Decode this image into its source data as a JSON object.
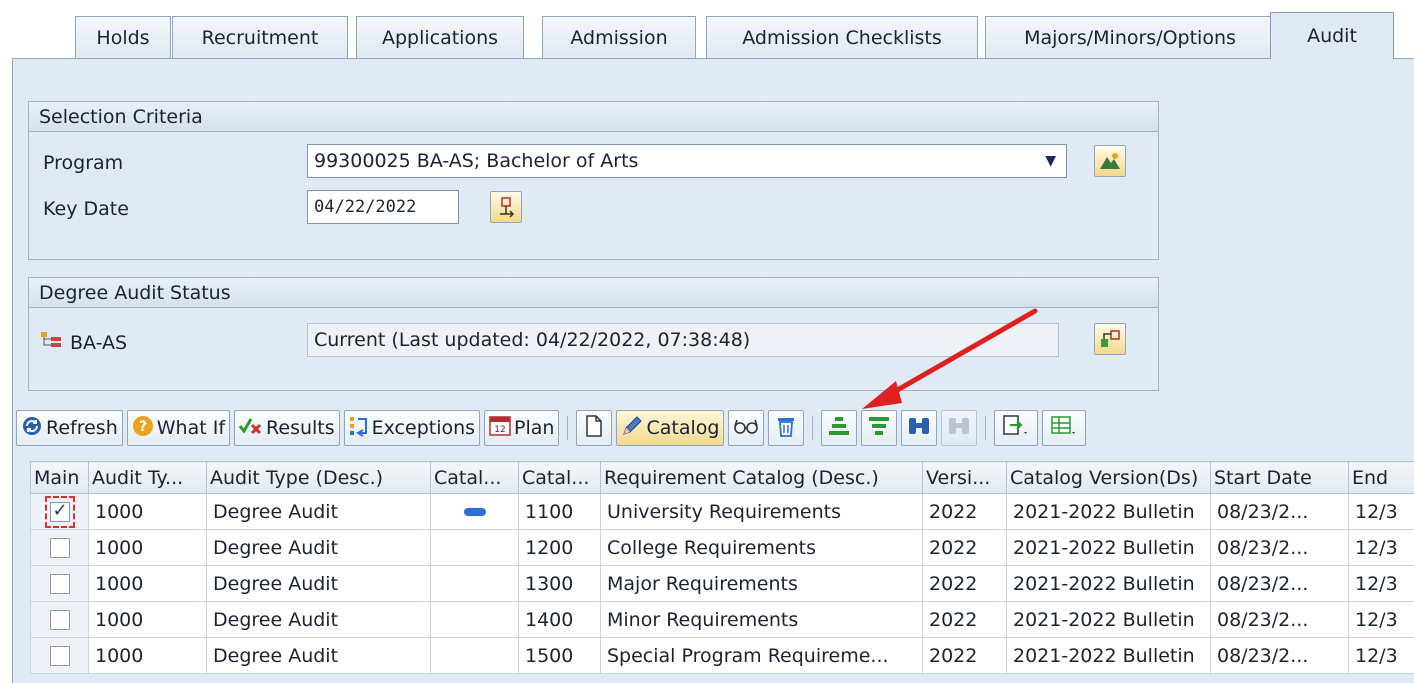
{
  "tabs": [
    {
      "label": "Holds"
    },
    {
      "label": "Recruitment"
    },
    {
      "label": "Applications"
    },
    {
      "label": "Admission"
    },
    {
      "label": "Admission Checklists"
    },
    {
      "label": "Majors/Minors/Options"
    },
    {
      "label": "Audit"
    }
  ],
  "selection": {
    "title": "Selection Criteria",
    "program_label": "Program",
    "program_value": "99300025 BA-AS; Bachelor of Arts",
    "key_date_label": "Key Date",
    "key_date_value": "04/22/2022"
  },
  "status": {
    "title": "Degree Audit Status",
    "program_code": "BA-AS",
    "status_text": "Current (Last updated: 04/22/2022, 07:38:48)"
  },
  "toolbar": {
    "refresh": "Refresh",
    "what_if": "What If",
    "results": "Results",
    "exceptions": "Exceptions",
    "plan": "Plan",
    "catalog": "Catalog"
  },
  "table": {
    "headers": [
      "Main",
      "Audit Ty...",
      "Audit Type (Desc.)",
      "Catal...",
      "Catal...",
      "Requirement Catalog (Desc.)",
      "Versi...",
      "Catalog Version(Ds)",
      "Start Date",
      "End"
    ],
    "rows": [
      {
        "main": true,
        "audit_type": "1000",
        "audit_desc": "Degree Audit",
        "cat1": "",
        "cat2": "1100",
        "req_desc": "University Requirements",
        "version": "2022",
        "cat_version": "2021-2022 Bulletin",
        "start": "08/23/2...",
        "end": "12/3"
      },
      {
        "main": false,
        "audit_type": "1000",
        "audit_desc": "Degree Audit",
        "cat1": "",
        "cat2": "1200",
        "req_desc": "College Requirements",
        "version": "2022",
        "cat_version": "2021-2022 Bulletin",
        "start": "08/23/2...",
        "end": "12/3"
      },
      {
        "main": false,
        "audit_type": "1000",
        "audit_desc": "Degree Audit",
        "cat1": "",
        "cat2": "1300",
        "req_desc": "Major Requirements",
        "version": "2022",
        "cat_version": "2021-2022 Bulletin",
        "start": "08/23/2...",
        "end": "12/3"
      },
      {
        "main": false,
        "audit_type": "1000",
        "audit_desc": "Degree Audit",
        "cat1": "",
        "cat2": "1400",
        "req_desc": "Minor Requirements",
        "version": "2022",
        "cat_version": "2021-2022 Bulletin",
        "start": "08/23/2...",
        "end": "12/3"
      },
      {
        "main": false,
        "audit_type": "1000",
        "audit_desc": "Degree Audit",
        "cat1": "",
        "cat2": "1500",
        "req_desc": "Special Program Requireme...",
        "version": "2022",
        "cat_version": "2021-2022 Bulletin",
        "start": "08/23/2...",
        "end": "12/3"
      }
    ]
  },
  "colors": {
    "panel_bg": "#dfeaf4",
    "annotation_arrow": "#e02020",
    "accent_blue": "#2a6fd6"
  },
  "icons": [
    "dropdown-arrow-icon",
    "program-search-icon",
    "date-picker-icon",
    "hierarchy-icon",
    "status-detail-icon",
    "refresh-icon",
    "help-icon",
    "results-icon",
    "exceptions-icon",
    "plan-icon",
    "new-document-icon",
    "pencil-icon",
    "glasses-icon",
    "trash-icon",
    "align-icon",
    "filter-icon",
    "binoculars-icon",
    "find-next-icon",
    "export-icon",
    "layout-icon"
  ]
}
